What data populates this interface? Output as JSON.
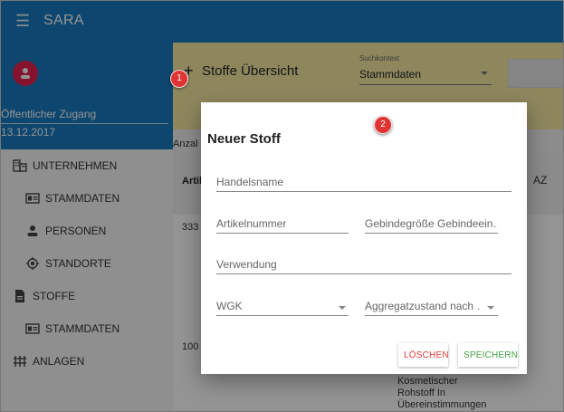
{
  "app": {
    "title": "SARA",
    "menu_icon": "hamburger-icon"
  },
  "sidebar": {
    "profile": {
      "avatar_icon": "person-icon",
      "access": "Öffentlicher Zugang",
      "date": "13.12.2017"
    },
    "items": [
      {
        "label": "UNTERNEHMEN",
        "icon": "building-icon",
        "level": 1
      },
      {
        "label": "STAMMDATEN",
        "icon": "id-card-icon",
        "level": 2
      },
      {
        "label": "PERSONEN",
        "icon": "person-icon",
        "level": 2
      },
      {
        "label": "STANDORTE",
        "icon": "location-target-icon",
        "level": 2
      },
      {
        "label": "STOFFE",
        "icon": "document-icon",
        "level": 1
      },
      {
        "label": "STAMMDATEN",
        "icon": "id-card-icon",
        "level": 2
      },
      {
        "label": "ANLAGEN",
        "icon": "plant-icon",
        "level": 1
      }
    ]
  },
  "main": {
    "add_icon": "+",
    "title": "Stoffe Übersicht",
    "search_context": {
      "label": "Suchkontext",
      "value": "Stammdaten"
    },
    "count_label": "Anzal",
    "table": {
      "header_article": "Artil",
      "sort_icon": "AZ",
      "rows": [
        {
          "value": "333"
        },
        {
          "value": ""
        },
        {
          "value": ""
        },
        {
          "value": "100"
        }
      ],
      "description_lines": [
        "Kosmetischer",
        "Rohstoff In",
        "Übereinstimmungen"
      ]
    }
  },
  "dialog": {
    "title": "Neuer Stoff",
    "fields": {
      "handelsname": "Handelsname",
      "artikelnummer": "Artikelnummer",
      "gebindegroesse": "Gebindegröße Gebindeein…",
      "verwendung": "Verwendung",
      "wgk": "WGK",
      "aggregatzustand": "Aggregatzustand nach …"
    },
    "buttons": {
      "delete": "LÖSCHEN",
      "save": "SPEICHERN"
    }
  },
  "markers": [
    "1",
    "2"
  ],
  "colors": {
    "primary": "#1779bd",
    "accent": "#e5214f",
    "search_bar": "#f5e9a2",
    "delete": "#e53935",
    "save": "#43a047"
  }
}
